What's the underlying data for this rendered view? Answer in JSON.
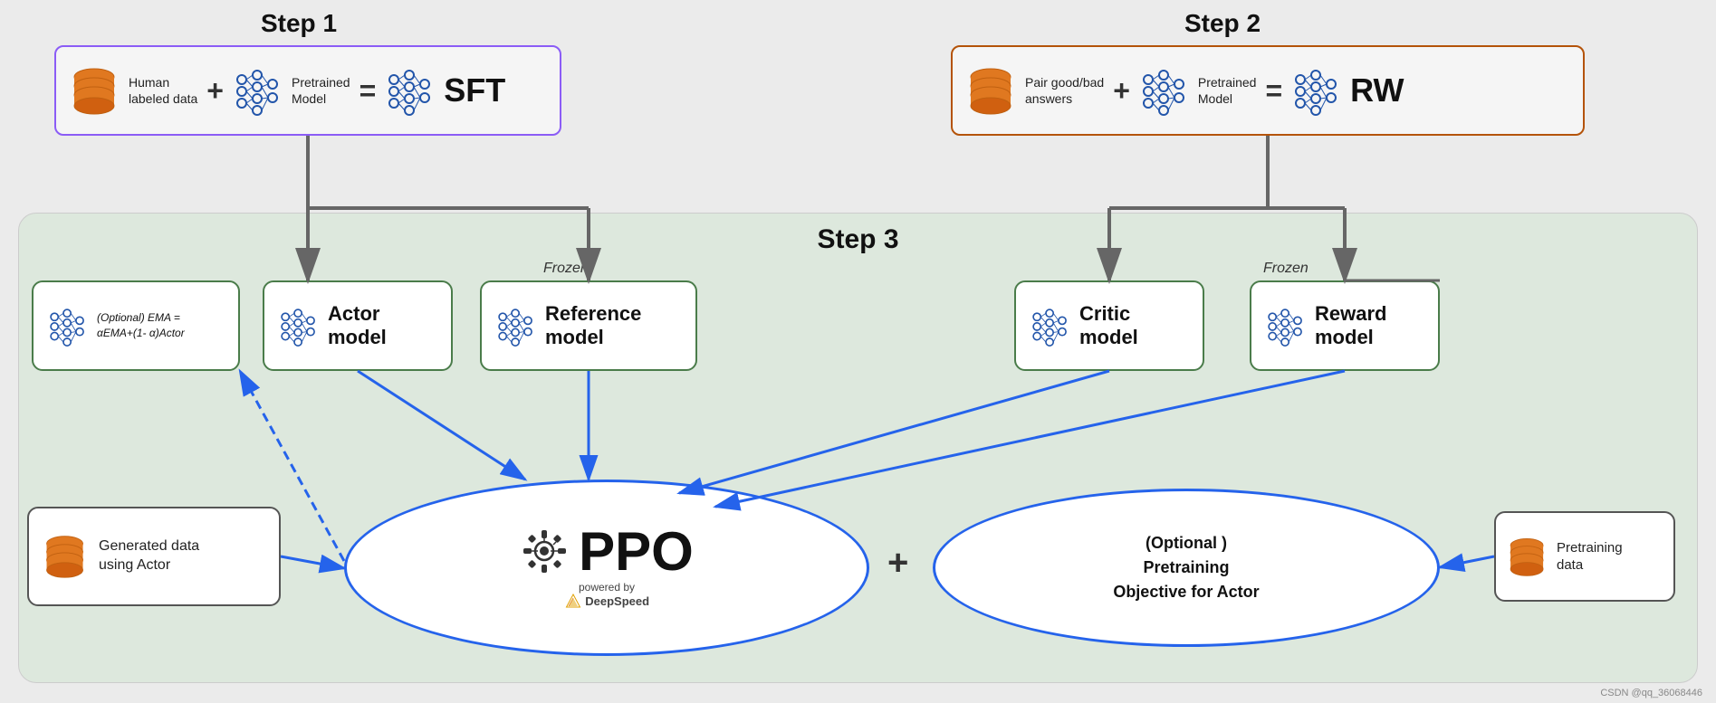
{
  "steps": {
    "step1": {
      "label": "Step 1",
      "box": {
        "label1": "Human\nlabeled data",
        "label2": "Pretrained\nModel",
        "result": "SFT"
      }
    },
    "step2": {
      "label": "Step 2",
      "box": {
        "label1": "Pair good/bad\nanswers",
        "label2": "Pretrained\nModel",
        "result": "RW"
      }
    },
    "step3": {
      "label": "Step 3",
      "models": {
        "ema": "(Optional) EMA =\nαEMA+(1- α)Actor",
        "actor": "Actor model",
        "reference": "Reference\nmodel",
        "critic": "Critic model",
        "reward": "Reward\nmodel"
      },
      "frozen1": "Frozen",
      "frozen2": "Frozen",
      "ppo": {
        "label": "PPO",
        "powered": "powered by",
        "deepspeed": "DeepSpeed"
      },
      "optional": "(Optional )\nPretraining\nObjective for Actor",
      "generated": "Generated data\nusing Actor",
      "pretraining": "Pretraining\ndata"
    }
  },
  "plus_sign": "+",
  "equals_sign": "=",
  "watermark": "CSDN @qq_36068446"
}
